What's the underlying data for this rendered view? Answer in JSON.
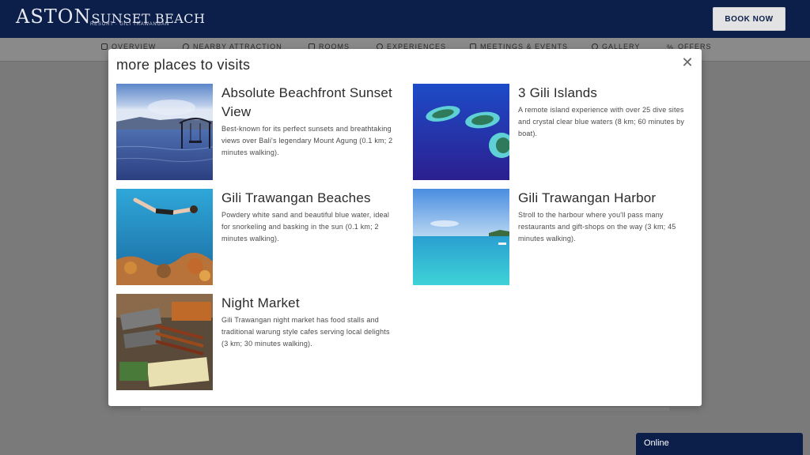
{
  "header": {
    "logo_main": "ASTON",
    "logo_second": "SUNSET BEACH",
    "logo_sub": "RESORT · GILI TRAWANGAN",
    "book_label": "BOOK NOW"
  },
  "nav": {
    "items": [
      {
        "label": "OVERVIEW",
        "icon": "overview-icon"
      },
      {
        "label": "NEARBY ATTRACTION",
        "icon": "location-pin-icon"
      },
      {
        "label": "ROOMS",
        "icon": "bed-icon"
      },
      {
        "label": "EXPERIENCES",
        "icon": "experience-icon"
      },
      {
        "label": "MEETINGS & EVENTS",
        "icon": "meeting-icon"
      },
      {
        "label": "GALLERY",
        "icon": "camera-icon"
      },
      {
        "label": "OFFERS",
        "icon": "percent-icon"
      }
    ]
  },
  "modal": {
    "title": "more places to visits",
    "close_icon": "close-icon",
    "places": [
      {
        "title": "Absolute Beachfront Sunset View",
        "description": "Best-known for its perfect sunsets and breathtaking views over Bali's legendary Mount Agung (0.1 km; 2 minutes walking).",
        "image": "sunset-swing-photo"
      },
      {
        "title": "3 Gili Islands",
        "description": "A remote island experience with over 25 dive sites and crystal clear blue waters (8 km; 60 minutes by boat).",
        "image": "aerial-islands-photo"
      },
      {
        "title": "Gili Trawangan Beaches",
        "description": "Powdery white sand and beautiful blue water, ideal for snorkeling and basking in the sun (0.1 km; 2 minutes walking).",
        "image": "snorkeling-photo"
      },
      {
        "title": "Gili Trawangan Harbor",
        "description": "Stroll to the harbour where you'll pass many restaurants and gift-shops on the way (3 km; 45 minutes walking).",
        "image": "turquoise-sea-photo"
      },
      {
        "title": "Night Market",
        "description": "Gili Trawangan night market has food stalls and traditional warung style cafes serving local delights (3 km; 30 minutes walking).",
        "image": "food-stall-photo"
      }
    ]
  },
  "chat": {
    "label": "Online"
  },
  "colors": {
    "brand_navy": "#0c1e4a",
    "overlay": "#7a7a7a"
  }
}
